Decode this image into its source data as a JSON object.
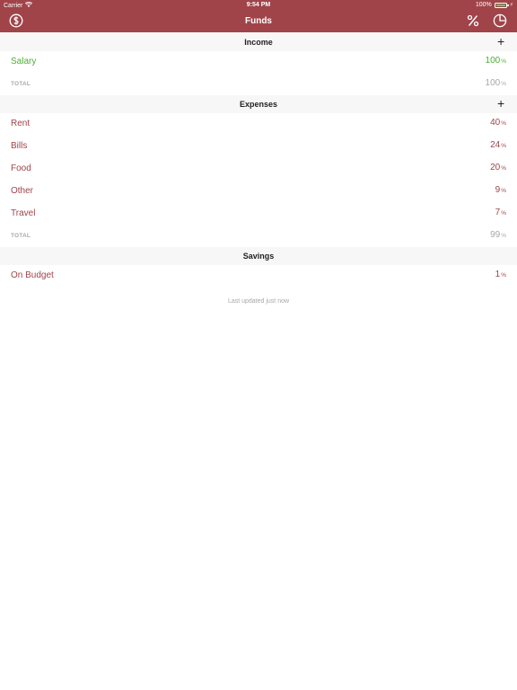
{
  "status": {
    "carrier": "Carrier",
    "time": "9:54 PM",
    "battery": "100%"
  },
  "nav": {
    "title": "Funds",
    "left_icon": "dollar-circle-icon",
    "percent_icon": "percent-icon",
    "pie_icon": "pie-chart-icon"
  },
  "colors": {
    "accent": "#a0444a",
    "positive": "#4caf37",
    "muted": "#a8a8a8"
  },
  "income": {
    "title": "Income",
    "add_label": "+",
    "items": [
      {
        "name": "Salary",
        "value": "100",
        "unit": "%"
      }
    ],
    "total_label": "TOTAL",
    "total_value": "100",
    "total_unit": "%"
  },
  "expenses": {
    "title": "Expenses",
    "add_label": "+",
    "items": [
      {
        "name": "Rent",
        "value": "40",
        "unit": "%"
      },
      {
        "name": "Bills",
        "value": "24",
        "unit": "%"
      },
      {
        "name": "Food",
        "value": "20",
        "unit": "%"
      },
      {
        "name": "Other",
        "value": "9",
        "unit": "%"
      },
      {
        "name": "Travel",
        "value": "7",
        "unit": "%"
      }
    ],
    "total_label": "TOTAL",
    "total_value": "99",
    "total_unit": "%"
  },
  "savings": {
    "title": "Savings",
    "items": [
      {
        "name": "On Budget",
        "value": "1",
        "unit": "%"
      }
    ]
  },
  "footer": {
    "text": "Last updated just now"
  }
}
